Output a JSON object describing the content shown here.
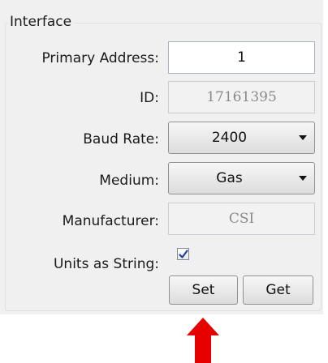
{
  "group": {
    "title": "Interface"
  },
  "fields": {
    "primary_address": {
      "label": "Primary Address:",
      "value": "1"
    },
    "id": {
      "label": "ID:",
      "value": "17161395"
    },
    "baud_rate": {
      "label": "Baud Rate:",
      "value": "2400"
    },
    "medium": {
      "label": "Medium:",
      "value": "Gas"
    },
    "manufacturer": {
      "label": "Manufacturer:",
      "value": "CSI"
    },
    "units_as_string": {
      "label": "Units as String:",
      "checked": true
    }
  },
  "buttons": {
    "set": "Set",
    "get": "Get"
  },
  "colors": {
    "annotation_arrow": "#e60000",
    "check": "#1e3f9a"
  }
}
